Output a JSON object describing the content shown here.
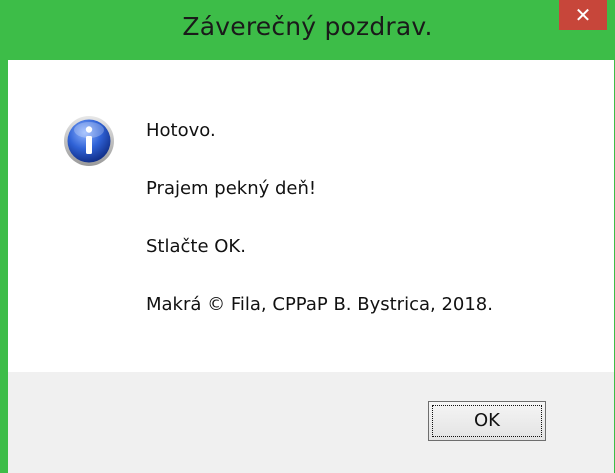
{
  "window": {
    "title": "Záverečný pozdrav.",
    "close_glyph": "✕",
    "accent_color": "#3dbd48",
    "close_color": "#c7463a"
  },
  "message": {
    "icon": "info-icon",
    "lines": [
      "Hotovo.",
      "Prajem pekný deň!",
      "Stlačte OK.",
      "Makrá © Fila, CPPaP B. Bystrica, 2018."
    ]
  },
  "buttons": {
    "ok_label": "OK"
  }
}
